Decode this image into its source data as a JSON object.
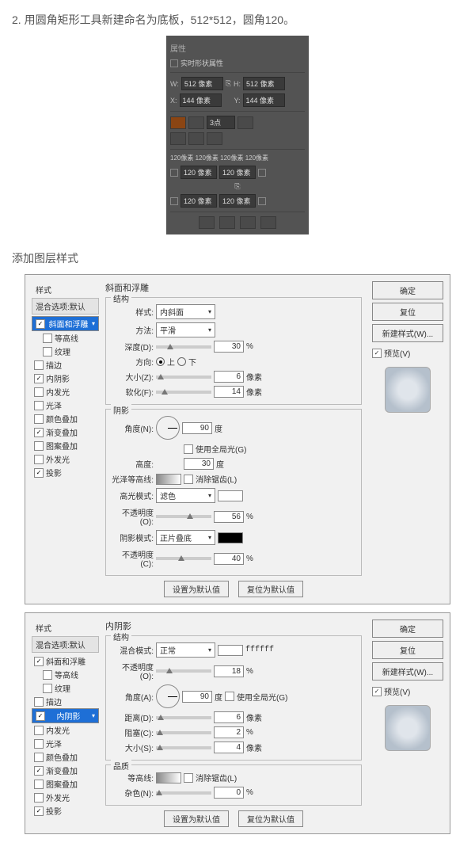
{
  "instruction": "2. 用圆角矩形工具新建命名为底板，512*512，圆角120。",
  "subtitle": "添加图层样式",
  "props": {
    "title": "属性",
    "shapeProps": "实时形状属性",
    "w_lbl": "W:",
    "w_val": "512 像素",
    "h_lbl": "H:",
    "h_val": "512 像素",
    "x_lbl": "X:",
    "x_val": "144 像素",
    "y_lbl": "Y:",
    "y_val": "144 像素",
    "stroke": "3点",
    "corners_line1": "120像素 120像素 120像素 120像素",
    "c1": "120 像素",
    "c2": "120 像素",
    "c3": "120 像素",
    "c4": "120 像素"
  },
  "d1": {
    "styles_hdr": "样式",
    "blend": "混合选项:默认",
    "items": [
      {
        "label": "斜面和浮雕",
        "on": true,
        "sel": true
      },
      {
        "label": "等高线",
        "on": false,
        "indent": true
      },
      {
        "label": "纹理",
        "on": false,
        "indent": true
      },
      {
        "label": "描边",
        "on": false
      },
      {
        "label": "内阴影",
        "on": true
      },
      {
        "label": "内发光",
        "on": false
      },
      {
        "label": "光泽",
        "on": false
      },
      {
        "label": "颜色叠加",
        "on": false
      },
      {
        "label": "渐变叠加",
        "on": true
      },
      {
        "label": "图案叠加",
        "on": false
      },
      {
        "label": "外发光",
        "on": false
      },
      {
        "label": "投影",
        "on": true
      }
    ],
    "title": "斜面和浮雕",
    "struct": "结构",
    "style_lbl": "样式:",
    "style_val": "内斜面",
    "method_lbl": "方法:",
    "method_val": "平滑",
    "depth_lbl": "深度(D):",
    "depth_val": "30",
    "depth_unit": "%",
    "dir_lbl": "方向:",
    "dir_up": "上",
    "dir_down": "下",
    "size_lbl": "大小(Z):",
    "size_val": "6",
    "px": "像素",
    "soften_lbl": "软化(F):",
    "soften_val": "14",
    "shade": "阴影",
    "angle_lbl": "角度(N):",
    "angle_val": "90",
    "deg": "度",
    "global": "使用全局光(G)",
    "alt_lbl": "高度:",
    "alt_val": "30",
    "gloss_lbl": "光泽等高线:",
    "anti": "消除锯齿(L)",
    "hmode_lbl": "高光模式:",
    "hmode_val": "滤色",
    "hop_lbl": "不透明度(O):",
    "hop_val": "56",
    "pct": "%",
    "smode_lbl": "阴影模式:",
    "smode_val": "正片叠底",
    "sop_lbl": "不透明度(C):",
    "sop_val": "40",
    "btn_default": "设置为默认值",
    "btn_reset": "复位为默认值",
    "ok": "确定",
    "cancel": "复位",
    "newstyle": "新建样式(W)...",
    "preview": "预览(V)"
  },
  "d2": {
    "items": [
      {
        "label": "斜面和浮雕",
        "on": true
      },
      {
        "label": "等高线",
        "on": false,
        "indent": true
      },
      {
        "label": "纹理",
        "on": false,
        "indent": true
      },
      {
        "label": "描边",
        "on": false
      },
      {
        "label": "内阴影",
        "on": true,
        "sel": true
      },
      {
        "label": "内发光",
        "on": false
      },
      {
        "label": "光泽",
        "on": false
      },
      {
        "label": "颜色叠加",
        "on": false
      },
      {
        "label": "渐变叠加",
        "on": true
      },
      {
        "label": "图案叠加",
        "on": false
      },
      {
        "label": "外发光",
        "on": false
      },
      {
        "label": "投影",
        "on": true
      }
    ],
    "title": "内阴影",
    "struct": "结构",
    "blend_lbl": "混合模式:",
    "blend_val": "正常",
    "color": "ffffff",
    "op_lbl": "不透明度(O):",
    "op_val": "18",
    "angle_lbl": "角度(A):",
    "angle_val": "90",
    "deg": "度",
    "global": "使用全局光(G)",
    "dist_lbl": "距离(D):",
    "dist_val": "6",
    "px": "像素",
    "choke_lbl": "阻塞(C):",
    "choke_val": "2",
    "pct": "%",
    "size_lbl": "大小(S):",
    "size_val": "4",
    "quality": "品质",
    "contour_lbl": "等高线:",
    "anti": "消除锯齿(L)",
    "noise_lbl": "杂色(N):",
    "noise_val": "0"
  }
}
